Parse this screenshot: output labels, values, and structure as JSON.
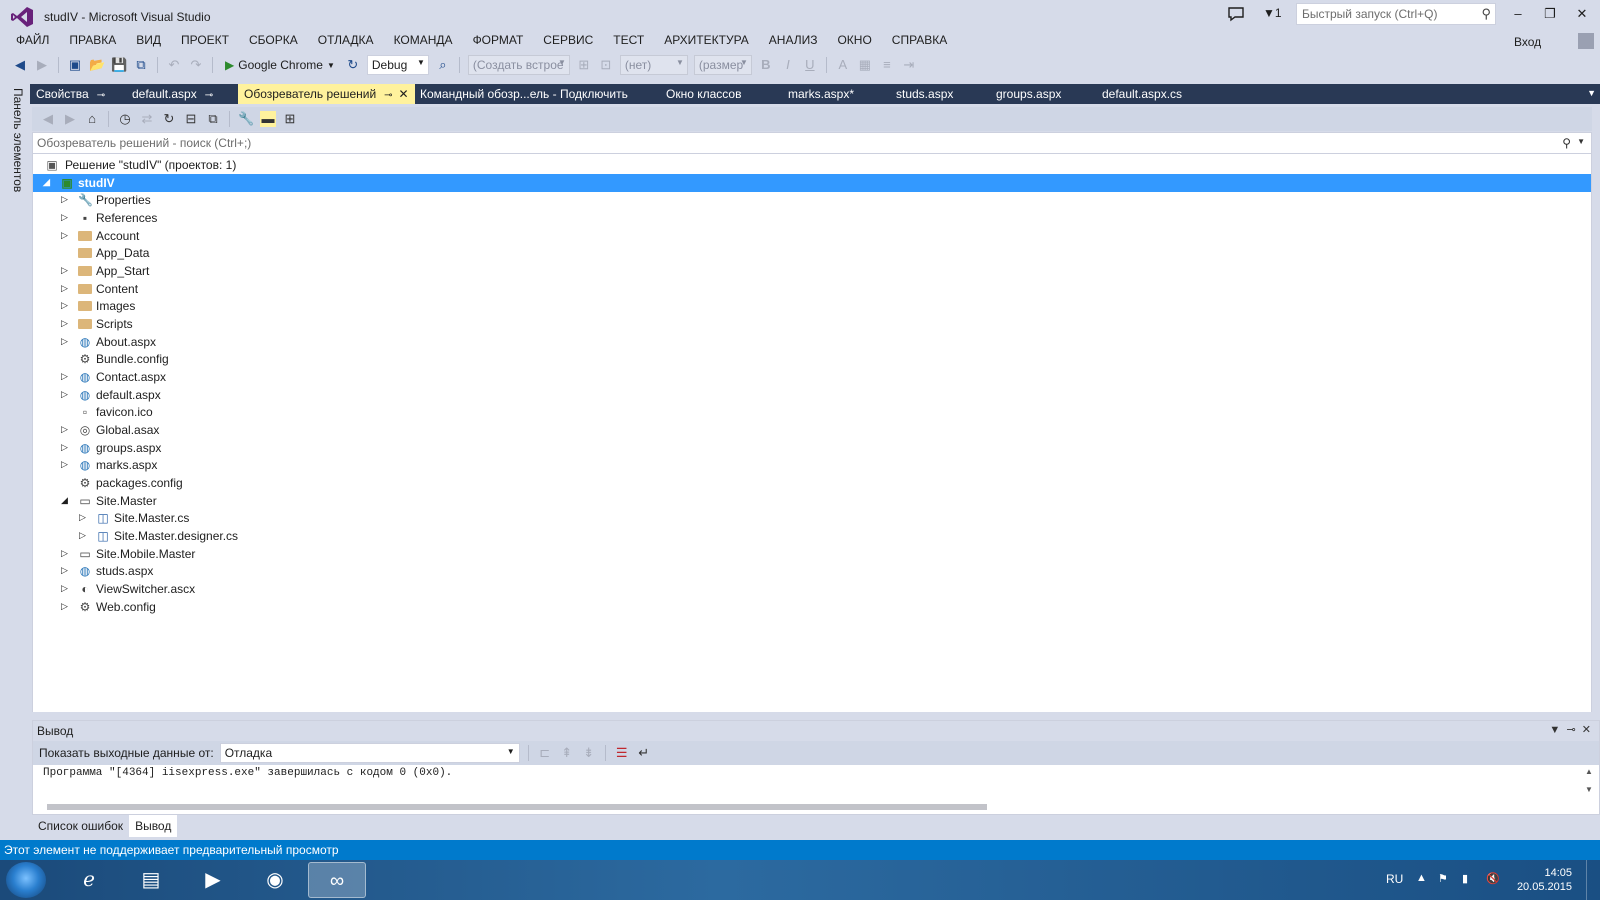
{
  "window": {
    "title": "studIV - Microsoft Visual Studio",
    "notifications_count": "1",
    "quick_launch_placeholder": "Быстрый запуск (Ctrl+Q)",
    "signin_label": "Вход"
  },
  "menu": [
    "ФАЙЛ",
    "ПРАВКА",
    "ВИД",
    "ПРОЕКТ",
    "СБОРКА",
    "ОТЛАДКА",
    "КОМАНДА",
    "ФОРМАТ",
    "СЕРВИС",
    "ТЕСТ",
    "АРХИТЕКТУРА",
    "АНАЛИЗ",
    "ОКНО",
    "СПРАВКА"
  ],
  "toolbar": {
    "run_target": "Google Chrome",
    "configuration": "Debug",
    "block_format": "(Создать встрое",
    "font_name": "(нет)",
    "font_size": "(размер"
  },
  "left_rail": {
    "toolbox_label": "Панель элементов"
  },
  "doc_tabs": [
    {
      "label": "Свойства"
    },
    {
      "label": "default.aspx"
    },
    {
      "label": "Обозреватель решений"
    },
    {
      "label": "Командный обозр...ель - Подключить"
    },
    {
      "label": "Окно классов"
    },
    {
      "label": "marks.aspx*"
    },
    {
      "label": "studs.aspx"
    },
    {
      "label": "groups.aspx"
    },
    {
      "label": "default.aspx.cs"
    }
  ],
  "solution_explorer": {
    "search_placeholder": "Обозреватель решений - поиск (Ctrl+;)",
    "tree": [
      {
        "label": "Решение \"studIV\"  (проектов: 1)",
        "level": 0,
        "expander": "",
        "icon": "solution-icon"
      },
      {
        "label": "studIV",
        "level": 0,
        "expander": "◢",
        "icon": "project-icon",
        "selected": true
      },
      {
        "label": "Properties",
        "level": 1,
        "expander": "▷",
        "icon": "wrench-icon"
      },
      {
        "label": "References",
        "level": 1,
        "expander": "▷",
        "icon": "references-icon"
      },
      {
        "label": "Account",
        "level": 1,
        "expander": "▷",
        "icon": "folder-icon"
      },
      {
        "label": "App_Data",
        "level": 1,
        "expander": "",
        "icon": "folder-icon"
      },
      {
        "label": "App_Start",
        "level": 1,
        "expander": "▷",
        "icon": "folder-icon"
      },
      {
        "label": "Content",
        "level": 1,
        "expander": "▷",
        "icon": "folder-icon"
      },
      {
        "label": "Images",
        "level": 1,
        "expander": "▷",
        "icon": "folder-icon"
      },
      {
        "label": "Scripts",
        "level": 1,
        "expander": "▷",
        "icon": "folder-icon"
      },
      {
        "label": "About.aspx",
        "level": 1,
        "expander": "▷",
        "icon": "web-form-icon"
      },
      {
        "label": "Bundle.config",
        "level": 1,
        "expander": "",
        "icon": "config-icon"
      },
      {
        "label": "Contact.aspx",
        "level": 1,
        "expander": "▷",
        "icon": "web-form-icon"
      },
      {
        "label": "default.aspx",
        "level": 1,
        "expander": "▷",
        "icon": "web-form-icon"
      },
      {
        "label": "favicon.ico",
        "level": 1,
        "expander": "",
        "icon": "ico-file-icon"
      },
      {
        "label": "Global.asax",
        "level": 1,
        "expander": "▷",
        "icon": "global-icon"
      },
      {
        "label": "groups.aspx",
        "level": 1,
        "expander": "▷",
        "icon": "web-form-icon"
      },
      {
        "label": "marks.aspx",
        "level": 1,
        "expander": "▷",
        "icon": "web-form-icon"
      },
      {
        "label": "packages.config",
        "level": 1,
        "expander": "",
        "icon": "config-icon"
      },
      {
        "label": "Site.Master",
        "level": 1,
        "expander": "◢",
        "icon": "master-page-icon"
      },
      {
        "label": "Site.Master.cs",
        "level": 2,
        "expander": "▷",
        "icon": "cs-file-icon"
      },
      {
        "label": "Site.Master.designer.cs",
        "level": 2,
        "expander": "▷",
        "icon": "cs-file-icon"
      },
      {
        "label": "Site.Mobile.Master",
        "level": 1,
        "expander": "▷",
        "icon": "master-page-icon"
      },
      {
        "label": "studs.aspx",
        "level": 1,
        "expander": "▷",
        "icon": "web-form-icon"
      },
      {
        "label": "ViewSwitcher.ascx",
        "level": 1,
        "expander": "▷",
        "icon": "user-control-icon"
      },
      {
        "label": "Web.config",
        "level": 1,
        "expander": "▷",
        "icon": "config-icon"
      }
    ]
  },
  "output": {
    "title": "Вывод",
    "source_label": "Показать выходные данные от:",
    "source_value": "Отладка",
    "text": "Программа \"[4364] iisexpress.exe\" завершилась с кодом 0 (0x0)."
  },
  "tool_tabs": [
    "Список ошибок",
    "Вывод"
  ],
  "status": {
    "text": "Этот элемент не поддерживает предварительный просмотр"
  },
  "taskbar": {
    "language": "RU",
    "time": "14:05",
    "date": "20.05.2015"
  }
}
